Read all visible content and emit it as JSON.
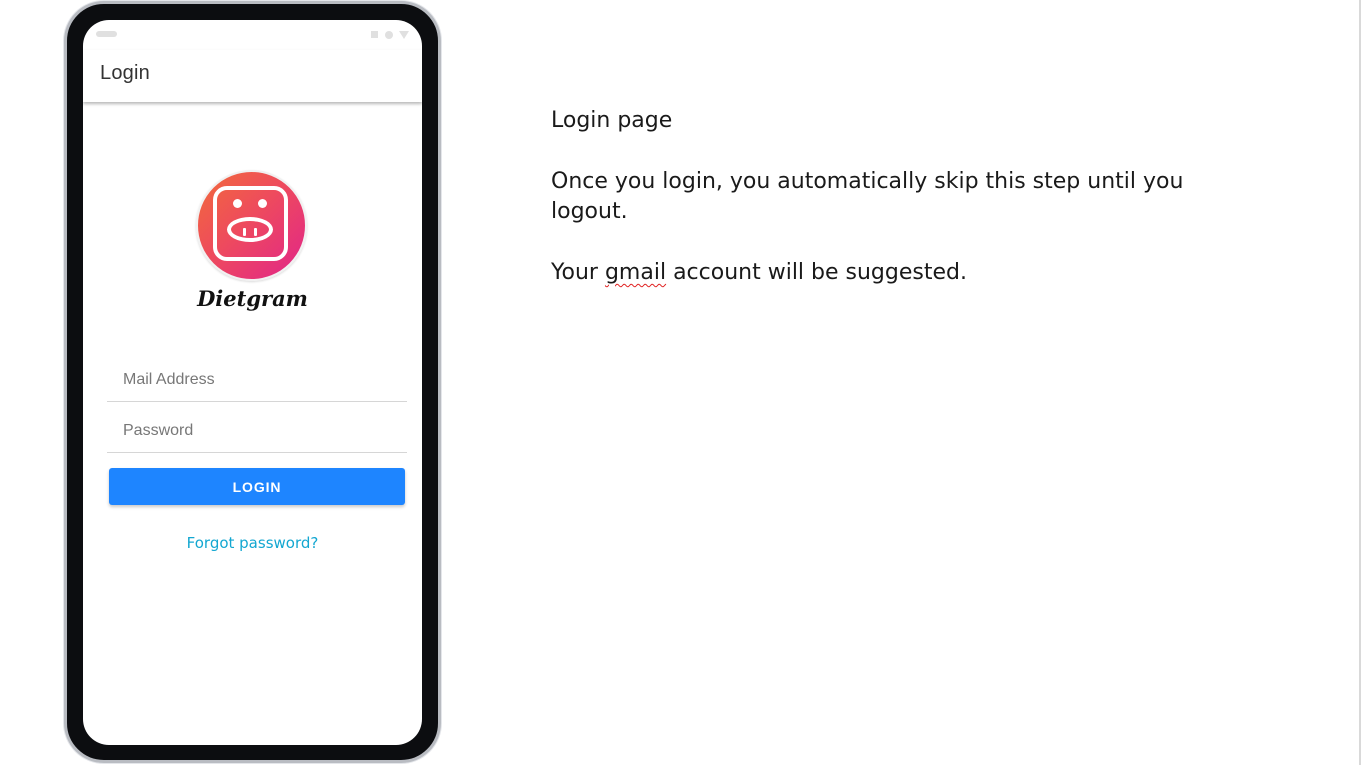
{
  "phone": {
    "app_bar": {
      "title": "Login"
    },
    "logo": {
      "icon": "pig-face-icon",
      "brand_name": "Dietgram"
    },
    "form": {
      "email_placeholder": "Mail Address",
      "email_value": "",
      "password_placeholder": "Password",
      "password_value": "",
      "login_label": "LOGIN",
      "forgot_label": "Forgot password?"
    }
  },
  "notes": {
    "line1": "Login page",
    "line2": "Once you login, you automatically skip this step until you logout.",
    "line3_pre": "Your ",
    "line3_word": "gmail",
    "line3_post": " account will be suggested."
  },
  "colors": {
    "primary_button": "#1e85ff",
    "link": "#13a7d1",
    "logo_gradient_start": "#f26b3a",
    "logo_gradient_end": "#e1248a"
  }
}
